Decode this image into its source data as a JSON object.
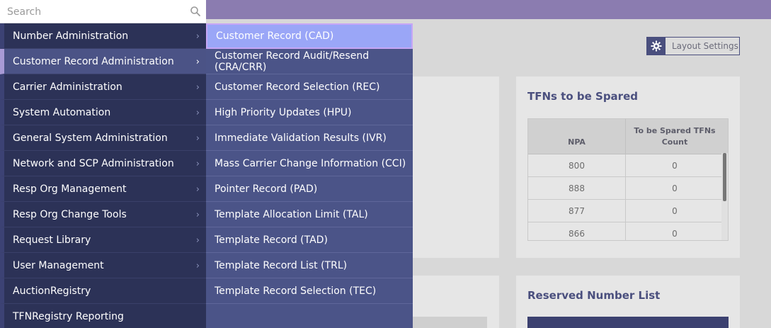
{
  "search": {
    "placeholder": "Search"
  },
  "menu": {
    "items": [
      {
        "label": "Number Administration",
        "chevron": true
      },
      {
        "label": "Customer Record Administration",
        "chevron": true,
        "active": true
      },
      {
        "label": "Carrier Administration",
        "chevron": true
      },
      {
        "label": "System Automation",
        "chevron": true
      },
      {
        "label": "General System Administration",
        "chevron": true
      },
      {
        "label": "Network and SCP Administration",
        "chevron": true
      },
      {
        "label": "Resp Org Management",
        "chevron": true
      },
      {
        "label": "Resp Org Change Tools",
        "chevron": true
      },
      {
        "label": "Request Library",
        "chevron": true
      },
      {
        "label": "User Management",
        "chevron": true
      },
      {
        "label": "AuctionRegistry",
        "chevron": false
      },
      {
        "label": "TFNRegistry Reporting",
        "chevron": false
      }
    ]
  },
  "submenu": {
    "items": [
      {
        "label": "Customer Record (CAD)",
        "selected": true
      },
      {
        "label": "Customer Record Audit/Resend (CRA/CRR)"
      },
      {
        "label": "Customer Record Selection (REC)"
      },
      {
        "label": "High Priority Updates (HPU)"
      },
      {
        "label": "Immediate Validation Results (IVR)"
      },
      {
        "label": "Mass Carrier Change Information (CCI)"
      },
      {
        "label": "Pointer Record (PAD)"
      },
      {
        "label": "Template Allocation Limit (TAL)"
      },
      {
        "label": "Template Record (TAD)"
      },
      {
        "label": "Template Record List (TRL)"
      },
      {
        "label": "Template Record Selection (TEC)"
      }
    ]
  },
  "layout_settings": {
    "label": "Layout Settings"
  },
  "tfn_card": {
    "title": "TFNs to be Spared",
    "columns": [
      "NPA",
      "To be Spared TFNs Count"
    ],
    "rows": [
      [
        "800",
        "0"
      ],
      [
        "888",
        "0"
      ],
      [
        "877",
        "0"
      ],
      [
        "866",
        "0"
      ]
    ]
  },
  "reserved_card": {
    "title": "Reserved Number List"
  },
  "colors": {
    "topbar": "#8b7cb0",
    "menu_bg": "#2c3257",
    "submenu_bg": "#4b5488",
    "selected_bg": "#9aa6f7",
    "accent": "#a89ad6"
  }
}
